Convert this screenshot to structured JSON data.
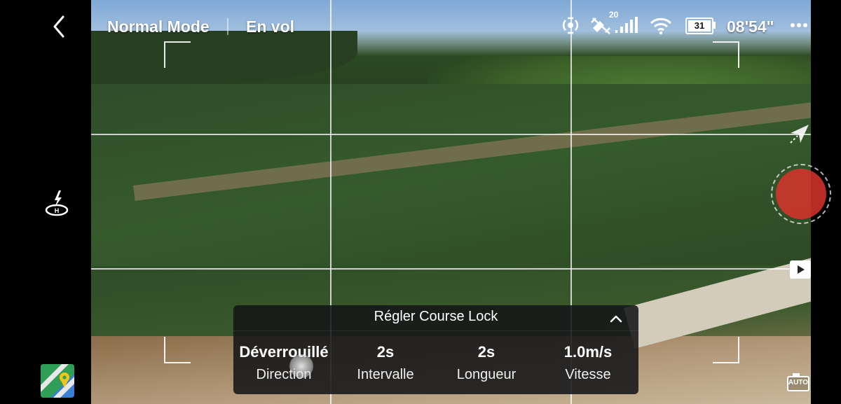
{
  "status_bar": {
    "mode": "Normal Mode",
    "flight_state": "En vol",
    "satellite_count": "20",
    "battery_level": "31",
    "flight_time": "08'54\""
  },
  "course_lock_panel": {
    "title": "Régler Course Lock",
    "settings": [
      {
        "value": "Déverrouillé",
        "label": "Direction"
      },
      {
        "value": "2s",
        "label": "Intervalle"
      },
      {
        "value": "2s",
        "label": "Longueur"
      },
      {
        "value": "1.0m/s",
        "label": "Vitesse"
      }
    ]
  },
  "auto_label": "AUTO",
  "icons": {
    "back": "chevron-left-icon",
    "takeoff": "auto-takeoff-icon",
    "map": "map-icon",
    "signal": "rc-signal-icon",
    "gps": "satellite-icon",
    "wifi": "wifi-icon",
    "battery": "battery-icon",
    "more": "more-icon",
    "shutter": "record-button",
    "playback": "playback-icon",
    "camera_auto": "camera-auto-icon"
  },
  "colors": {
    "record_red": "#d9332b"
  }
}
